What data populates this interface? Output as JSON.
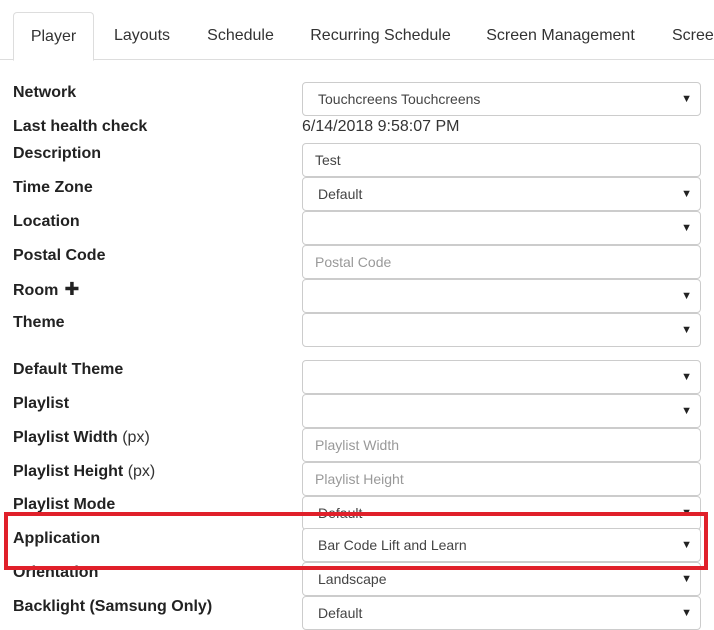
{
  "tabs": [
    {
      "label": "Player",
      "active": true
    },
    {
      "label": "Layouts"
    },
    {
      "label": "Schedule"
    },
    {
      "label": "Recurring Schedule"
    },
    {
      "label": "Screen Management"
    },
    {
      "label": "Scree"
    }
  ],
  "form": {
    "network": {
      "label": "Network",
      "value": "Touchcreens Touchcreens"
    },
    "last_health_check": {
      "label": "Last health check",
      "value": "6/14/2018 9:58:07 PM"
    },
    "description": {
      "label": "Description",
      "value": "Test"
    },
    "time_zone": {
      "label": "Time Zone",
      "value": "Default"
    },
    "location": {
      "label": "Location",
      "value": ""
    },
    "postal_code": {
      "label": "Postal Code",
      "placeholder": "Postal Code"
    },
    "room": {
      "label": "Room",
      "value": ""
    },
    "theme": {
      "label": "Theme",
      "value": ""
    },
    "default_theme": {
      "label": "Default Theme",
      "value": ""
    },
    "playlist": {
      "label": "Playlist",
      "value": ""
    },
    "playlist_width": {
      "label": "Playlist Width",
      "unit": "(px)",
      "placeholder": "Playlist Width"
    },
    "playlist_height": {
      "label": "Playlist Height",
      "unit": "(px)",
      "placeholder": "Playlist Height"
    },
    "playlist_mode": {
      "label": "Playlist Mode",
      "value": "Default"
    },
    "application": {
      "label": "Application",
      "value": "Bar Code Lift and Learn"
    },
    "orientation": {
      "label": "Orientation",
      "value": "Landscape"
    },
    "backlight": {
      "label": "Backlight (Samsung Only)",
      "value": "Default"
    }
  },
  "icons": {
    "caret": "▼",
    "plus": "✚"
  },
  "colors": {
    "highlight_border": "#e0202a",
    "field_border": "#cccccc"
  }
}
